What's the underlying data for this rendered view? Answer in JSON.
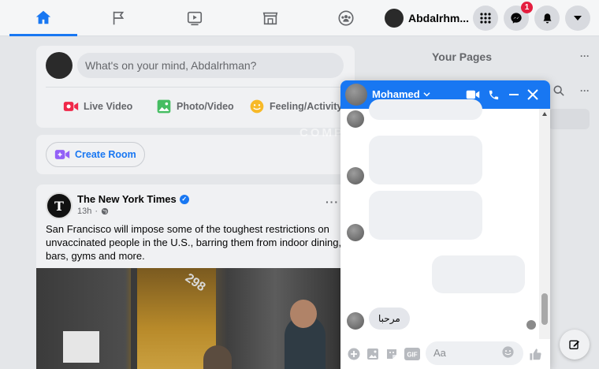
{
  "nav": {
    "tabs": [
      {
        "name": "home",
        "icon": "home-icon",
        "active": true
      },
      {
        "name": "pages",
        "icon": "flag-icon",
        "active": false
      },
      {
        "name": "watch",
        "icon": "video-icon",
        "active": false
      },
      {
        "name": "marketplace",
        "icon": "store-icon",
        "active": false
      },
      {
        "name": "groups",
        "icon": "groups-icon",
        "active": false
      }
    ],
    "profile_name": "Abdalrhm...",
    "messenger_badge": "1",
    "accent": "#1877f2"
  },
  "composer": {
    "placeholder": "What's on your mind, Abdalrhman?",
    "live_video": "Live Video",
    "photo_video": "Photo/Video",
    "feeling": "Feeling/Activity"
  },
  "room": {
    "create_room": "Create Room"
  },
  "post": {
    "page_name": "The New York Times",
    "logo_letter": "T",
    "time": "13h",
    "text": "San Francisco will impose some of the toughest restrictions on unvaccinated people in the U.S., barring them from indoor dining, bars, gyms and more.",
    "menu": "···",
    "photo_number": "298"
  },
  "right": {
    "your_pages": "Your Pages",
    "dots": "···"
  },
  "watermark": "COMPUTERWD.COM",
  "chat": {
    "name": "Mohamed",
    "message_text": "مرحبا",
    "input_placeholder": "Aa"
  }
}
